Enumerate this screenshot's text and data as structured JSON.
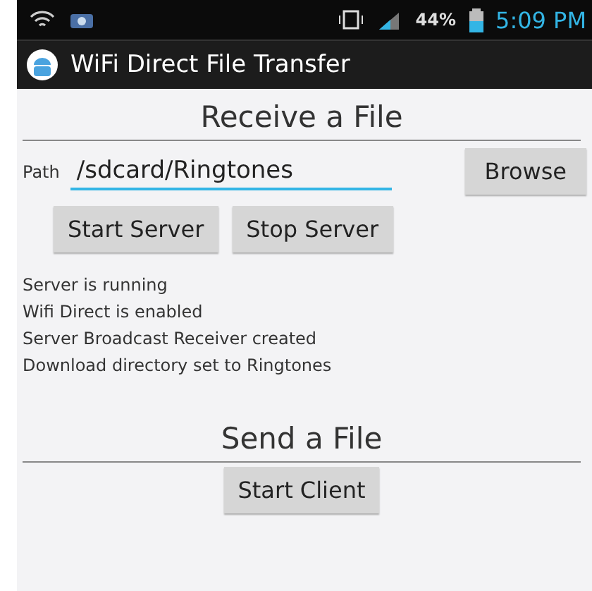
{
  "status_bar": {
    "battery": "44%",
    "time": "5:09 PM"
  },
  "app_bar": {
    "title": "WiFi Direct File Transfer"
  },
  "receive": {
    "heading": "Receive a File",
    "path_label": "Path",
    "path_value": "/sdcard/Ringtones",
    "browse": "Browse",
    "buttons": [
      "Start Server",
      "Stop Server"
    ],
    "log": [
      "Server is running",
      "Wifi Direct is enabled",
      "Server Broadcast Receiver created",
      "Download directory set to Ringtones"
    ]
  },
  "send": {
    "heading": "Send a File",
    "button": "Start Client"
  }
}
